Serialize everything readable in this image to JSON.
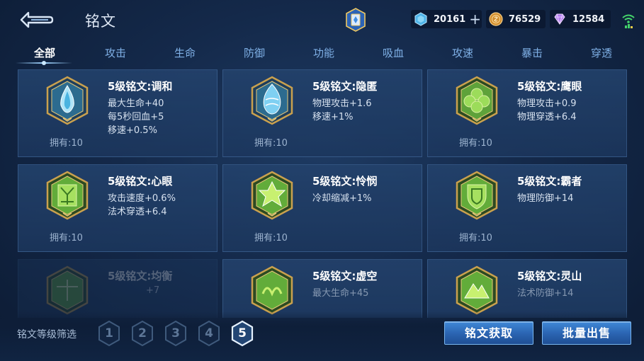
{
  "header": {
    "title": "铭文",
    "currencies": [
      {
        "icon": "blue-gem-icon",
        "value": "20161",
        "color": "#59c3f0"
      },
      {
        "icon": "gold-coin-icon",
        "value": "76529",
        "color": "#e2a64a"
      },
      {
        "icon": "purple-diamond-icon",
        "value": "12584",
        "color": "#c48cf3"
      }
    ]
  },
  "tabs": [
    "全部",
    "攻击",
    "生命",
    "防御",
    "功能",
    "吸血",
    "攻速",
    "暴击",
    "穿透"
  ],
  "active_tab": "全部",
  "cards": [
    {
      "name": "5级铭文:调和",
      "attrs": [
        "最大生命+40",
        "每5秒回血+5",
        "移速+0.5%"
      ],
      "owned": "拥有:10",
      "color": "blue"
    },
    {
      "name": "5级铭文:隐匿",
      "attrs": [
        "物理攻击+1.6",
        "移速+1%"
      ],
      "owned": "拥有:10",
      "color": "blue"
    },
    {
      "name": "5级铭文:鹰眼",
      "attrs": [
        "物理攻击+0.9",
        "物理穿透+6.4"
      ],
      "owned": "拥有:10",
      "color": "green"
    },
    {
      "name": "5级铭文:心眼",
      "attrs": [
        "攻击速度+0.6%",
        "法术穿透+6.4"
      ],
      "owned": "拥有:10",
      "color": "green"
    },
    {
      "name": "5级铭文:怜悯",
      "attrs": [
        "冷却缩减+1%"
      ],
      "owned": "拥有:10",
      "color": "green"
    },
    {
      "name": "5级铭文:霸者",
      "attrs": [
        "物理防御+14"
      ],
      "owned": "拥有:10",
      "color": "green"
    },
    {
      "name": "5级铭文:均衡",
      "attrs": [
        "+7"
      ],
      "owned": "",
      "color": "green"
    },
    {
      "name": "5级铭文:虚空",
      "attrs": [
        "最大生命+45"
      ],
      "owned": "",
      "color": "green"
    },
    {
      "name": "5级铭文:灵山",
      "attrs": [
        "法术防御+14"
      ],
      "owned": "",
      "color": "green"
    }
  ],
  "footer": {
    "filter_label": "铭文等级筛选",
    "levels": [
      "1",
      "2",
      "3",
      "4",
      "5"
    ],
    "active_level": "5",
    "obtain_label": "铭文获取",
    "sell_label": "批量出售"
  }
}
